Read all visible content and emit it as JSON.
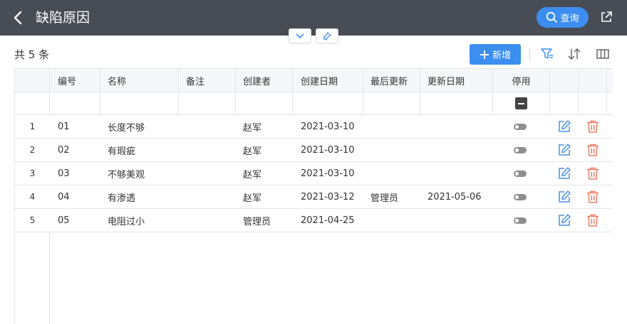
{
  "header": {
    "title": "缺陷原因",
    "query_label": "查询"
  },
  "summary": {
    "count_label": "共 5 条"
  },
  "toolbar": {
    "add_label": "新增"
  },
  "table": {
    "columns": [
      "编号",
      "名称",
      "备注",
      "创建者",
      "创建日期",
      "最后更新",
      "更新日期",
      "停用"
    ],
    "rows": [
      {
        "index": "1",
        "code": "01",
        "name": "长度不够",
        "note": "",
        "creator": "赵军",
        "created": "2021-03-10",
        "updater": "",
        "updated": ""
      },
      {
        "index": "2",
        "code": "02",
        "name": "有瑕疵",
        "note": "",
        "creator": "赵军",
        "created": "2021-03-10",
        "updater": "",
        "updated": ""
      },
      {
        "index": "3",
        "code": "03",
        "name": "不够美观",
        "note": "",
        "creator": "赵军",
        "created": "2021-03-10",
        "updater": "",
        "updated": ""
      },
      {
        "index": "4",
        "code": "04",
        "name": "有渗透",
        "note": "",
        "creator": "赵军",
        "created": "2021-03-12",
        "updater": "管理员",
        "updated": "2021-05-06"
      },
      {
        "index": "5",
        "code": "05",
        "name": "电阻过小",
        "note": "",
        "creator": "管理员",
        "created": "2021-04-25",
        "updater": "",
        "updated": ""
      }
    ]
  },
  "colors": {
    "header_bg": "#474c55",
    "accent": "#3c8ef0",
    "delete": "#ee7b63",
    "edit": "#4a90e2"
  },
  "icons": [
    "back-arrow-icon",
    "search-icon",
    "share-icon",
    "chevron-down-icon",
    "pin-icon",
    "plus-icon",
    "filter-icon",
    "sort-icon",
    "columns-icon",
    "edit-icon",
    "trash-icon",
    "minus-icon"
  ]
}
